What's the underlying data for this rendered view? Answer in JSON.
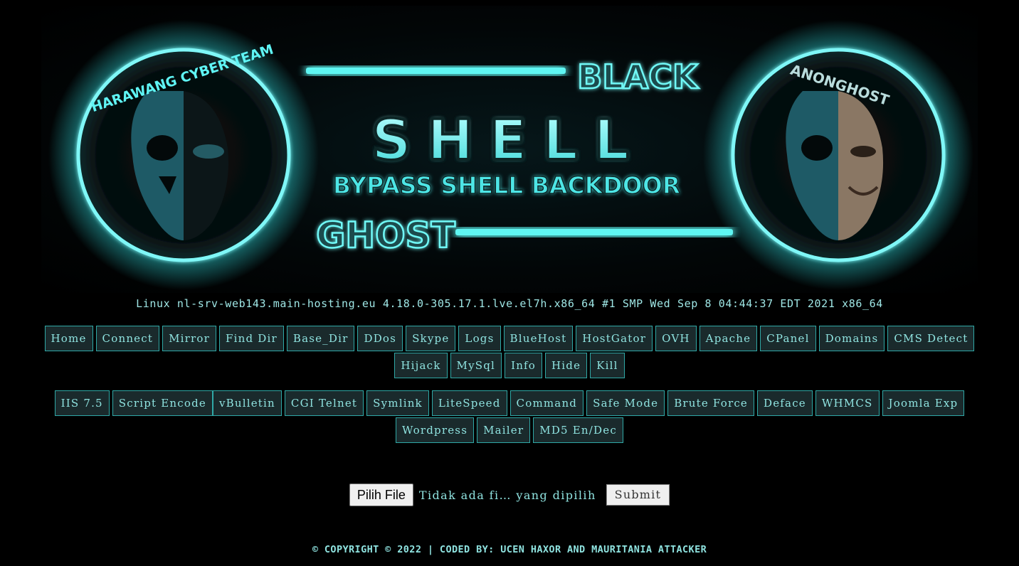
{
  "banner": {
    "left_badge_text": "HARAWANG CYBER TEAM",
    "right_badge_text": "ANONGHOST",
    "word_black": "BLACK",
    "word_shell": "SHELL",
    "subtitle": "BYPASS SHELL BACKDOOR",
    "word_ghost": "GHOST",
    "accent_color": "#3ff0f0"
  },
  "system_info": "Linux nl-srv-web143.main-hosting.eu 4.18.0-305.17.1.lve.el7h.x86_64 #1 SMP Wed Sep 8 04:44:37 EDT 2021 x86_64",
  "menu1": {
    "items": [
      "Home",
      "Connect",
      "Mirror",
      "Find Dir",
      "Base_Dir",
      "DDos",
      "Skype",
      "Logs",
      "BlueHost",
      "HostGator",
      "OVH",
      "Apache",
      "CPanel",
      "Domains",
      "CMS Detect",
      "Hijack",
      "MySql",
      "Info",
      "Hide",
      "Kill"
    ]
  },
  "menu2": {
    "items": [
      "IIS 7.5",
      "Script Encode",
      "vBulletin",
      "CGI Telnet",
      "Symlink",
      "LiteSpeed",
      "Command",
      "Safe Mode",
      "Brute Force",
      "Deface",
      "WHMCS",
      "Joomla Exp",
      "Wordpress",
      "Mailer",
      "MD5 En/Dec"
    ]
  },
  "upload": {
    "file_button_label": "Pilih File",
    "file_status": "Tidak ada fi… yang dipilih",
    "submit_label": "Submit"
  },
  "footer": "© COPYRIGHT © 2022 | CODED BY: UCEN HAXOR AND MAURITANIA ATTACKER",
  "colors": {
    "background": "#000000",
    "text": "#8fe3e0",
    "button_bg": "#1a2a2c",
    "button_border": "#2fa8a6"
  }
}
